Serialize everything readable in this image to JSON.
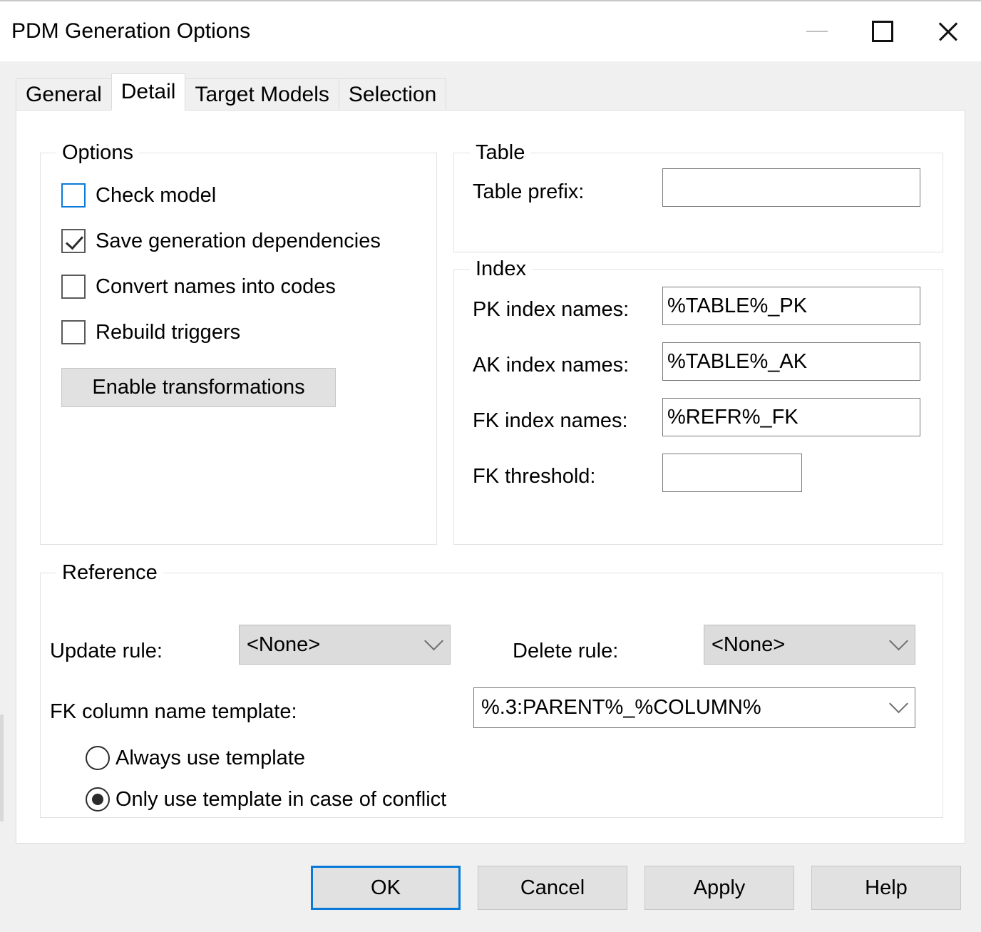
{
  "window": {
    "title": "PDM Generation Options",
    "controls": {
      "minimize": "minimize-icon",
      "maximize": "maximize-icon",
      "close": "close-icon"
    }
  },
  "tabs": [
    {
      "label": "General",
      "active": false
    },
    {
      "label": "Detail",
      "active": true
    },
    {
      "label": "Target Models",
      "active": false
    },
    {
      "label": "Selection",
      "active": false
    }
  ],
  "options_group": {
    "title": "Options",
    "checkboxes": [
      {
        "label": "Check model",
        "checked": false,
        "focused": true
      },
      {
        "label": "Save generation dependencies",
        "checked": true,
        "focused": false
      },
      {
        "label": "Convert names into codes",
        "checked": false,
        "focused": false
      },
      {
        "label": "Rebuild triggers",
        "checked": false,
        "focused": false
      }
    ],
    "enable_transformations_label": "Enable transformations"
  },
  "table_group": {
    "title": "Table",
    "table_prefix_label": "Table prefix:",
    "table_prefix_value": ""
  },
  "index_group": {
    "title": "Index",
    "pk_label": "PK index names:",
    "pk_value": "%TABLE%_PK",
    "ak_label": "AK index names:",
    "ak_value": "%TABLE%_AK",
    "fk_label": "FK index names:",
    "fk_value": "%REFR%_FK",
    "fk_threshold_label": "FK threshold:",
    "fk_threshold_value": ""
  },
  "reference_group": {
    "title": "Reference",
    "update_rule_label": "Update rule:",
    "update_rule_value": "<None>",
    "delete_rule_label": "Delete rule:",
    "delete_rule_value": "<None>",
    "fk_template_label": "FK column name template:",
    "fk_template_value": "%.3:PARENT%_%COLUMN%",
    "radios": [
      {
        "label": "Always use template",
        "selected": false
      },
      {
        "label": "Only use template in case of conflict",
        "selected": true
      }
    ]
  },
  "footer": {
    "ok": "OK",
    "cancel": "Cancel",
    "apply": "Apply",
    "help": "Help"
  },
  "colors": {
    "accent": "#0a7ad8",
    "dialog_bg": "#f0f0f0",
    "page_bg": "#ffffff",
    "button_face": "#e1e1e1",
    "combo_face": "#dcdcdc"
  }
}
